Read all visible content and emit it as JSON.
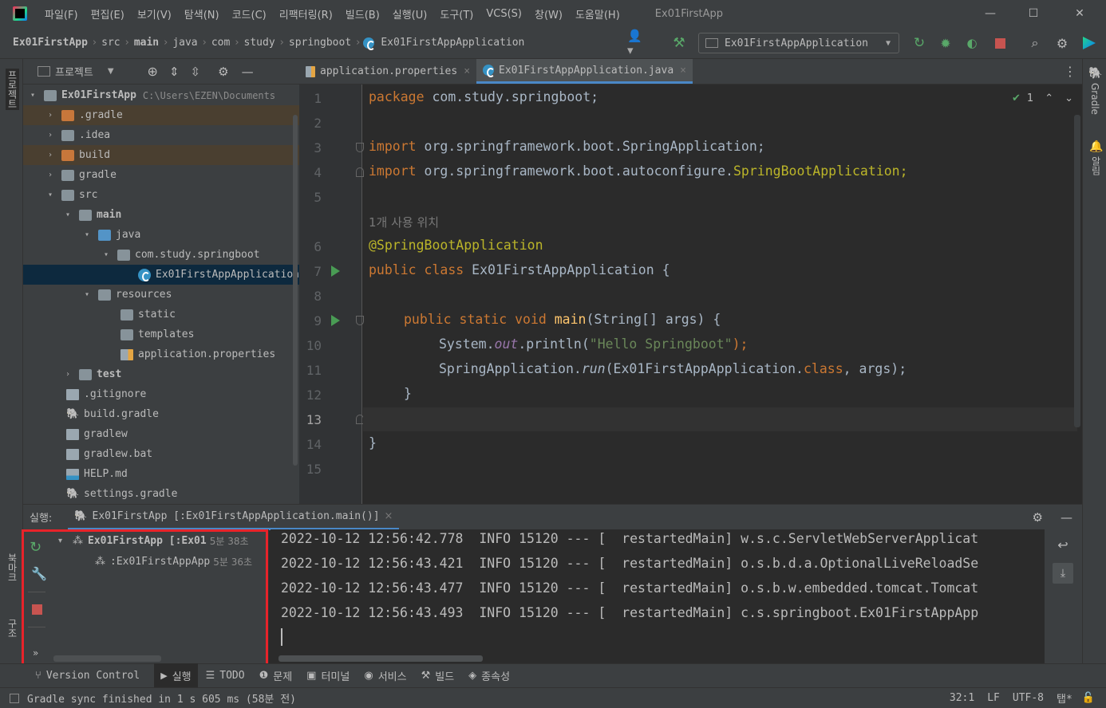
{
  "menu": {
    "items": [
      "파일(F)",
      "편집(E)",
      "보기(V)",
      "탐색(N)",
      "코드(C)",
      "리팩터링(R)",
      "빌드(B)",
      "실행(U)",
      "도구(T)",
      "VCS(S)",
      "창(W)",
      "도움말(H)"
    ],
    "window_title": "Ex01FirstApp"
  },
  "breadcrumb": [
    "Ex01FirstApp",
    "src",
    "main",
    "java",
    "com",
    "study",
    "springboot",
    "Ex01FirstAppApplication"
  ],
  "run_config": {
    "label": "Ex01FirstAppApplication"
  },
  "project_panel": {
    "title": "프로젝트",
    "root_name": "Ex01FirstApp",
    "root_path": "C:\\Users\\EZEN\\Documents",
    "items": [
      ".gradle",
      ".idea",
      "build",
      "gradle",
      "src",
      "main",
      "java",
      "com.study.springboot",
      "Ex01FirstAppApplication",
      "resources",
      "static",
      "templates",
      "application.properties",
      "test",
      ".gitignore",
      "build.gradle",
      "gradlew",
      "gradlew.bat",
      "HELP.md",
      "settings.gradle"
    ]
  },
  "editor": {
    "tabs": [
      "application.properties",
      "Ex01FirstAppApplication.java"
    ],
    "active_tab": 1,
    "inspection_count": "1",
    "line_numbers": [
      "1",
      "2",
      "3",
      "4",
      "5",
      "6",
      "7",
      "8",
      "9",
      "10",
      "11",
      "12",
      "13",
      "14",
      "15"
    ],
    "usage_hint": "1개 사용 위치",
    "code": {
      "package_kw": "package",
      "package_name": " com.study.springboot;",
      "import_kw": "import",
      "import1": " org.springframework.boot.SpringApplication;",
      "import2_a": " org.springframework.boot.autoconfigure.",
      "import2_b": "SpringBootApplication;",
      "annotation": "@SpringBootApplication",
      "class_line_kw": "public class",
      "class_line_rest": " Ex01FirstAppApplication {",
      "main_kw": "public static void",
      "main_name": " main",
      "main_rest": "(String[] args) {",
      "println_a": "System.",
      "println_out": "out",
      "println_b": ".println(",
      "println_str": "\"Hello Springboot\"",
      "println_c": ");",
      "run_a": "SpringApplication.",
      "run_m": "run",
      "run_b": "(Ex01FirstAppApplication.",
      "run_kw": "class",
      "run_c": ", args);",
      "close_brace_inner": "}",
      "close_brace_outer": "}"
    }
  },
  "run_panel": {
    "label": "실행:",
    "tab_title": "Ex01FirstApp [:Ex01FirstAppApplication.main()]",
    "tree": [
      {
        "name": "Ex01FirstApp [:Ex01",
        "time": "5분 38초"
      },
      {
        "name": ":Ex01FirstAppApp",
        "time": "5분 36초"
      }
    ],
    "log_lines": [
      "2022-10-12 12:56:42.778  INFO 15120 --- [  restartedMain] w.s.c.ServletWebServerApplicat",
      "2022-10-12 12:56:43.421  INFO 15120 --- [  restartedMain] o.s.b.d.a.OptionalLiveReloadSe",
      "2022-10-12 12:56:43.477  INFO 15120 --- [  restartedMain] o.s.b.w.embedded.tomcat.Tomcat",
      "2022-10-12 12:56:43.493  INFO 15120 --- [  restartedMain] c.s.springboot.Ex01FirstAppApp"
    ]
  },
  "bottom_tabs": [
    "Version Control",
    "실행",
    "TODO",
    "문제",
    "터미널",
    "서비스",
    "빌드",
    "종속성"
  ],
  "side_labels": {
    "left_top": "프로젝트",
    "left_bottom": "북마크",
    "left_structure": "구조",
    "right_gradle": "Gradle",
    "right_notify": "알림"
  },
  "status": {
    "message": "Gradle sync finished in 1 s 605 ms (58분 전)",
    "position": "32:1",
    "line_sep": "LF",
    "encoding": "UTF-8",
    "indent": "탭*"
  }
}
